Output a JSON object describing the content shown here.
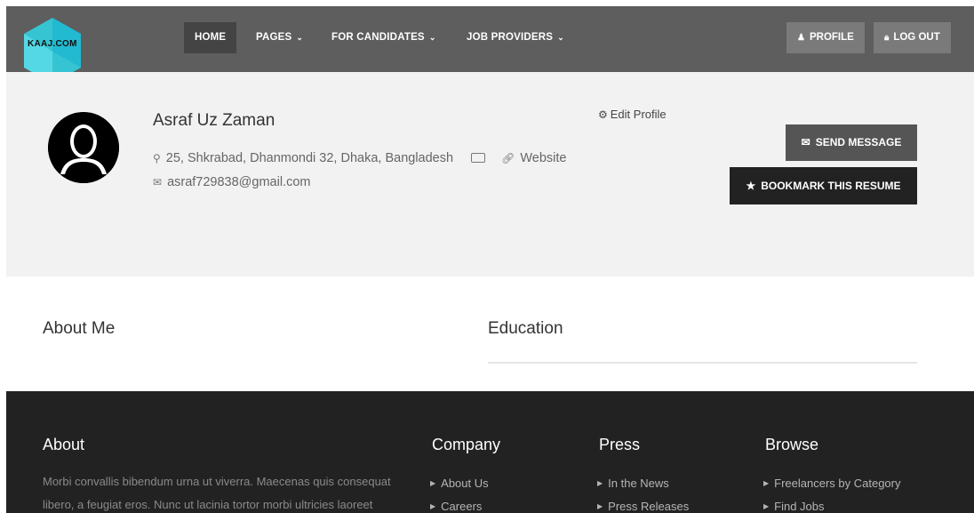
{
  "header": {
    "logo_text": "KAAJ.COM",
    "nav": [
      {
        "label": "HOME"
      },
      {
        "label": "PAGES"
      },
      {
        "label": "FOR CANDIDATES"
      },
      {
        "label": "JOB PROVIDERS"
      }
    ],
    "profile_label": "PROFILE",
    "logout_label": "LOG OUT"
  },
  "profile": {
    "name": "Asraf Uz Zaman",
    "address": "25, Shkrabad, Dhanmondi 32, Dhaka, Bangladesh",
    "website_label": "Website",
    "email": "asraf729838@gmail.com",
    "edit_label": "Edit Profile",
    "send_message_label": "SEND MESSAGE",
    "bookmark_label": "BOOKMARK THIS RESUME"
  },
  "sections": {
    "about_title": "About Me",
    "education_title": "Education"
  },
  "footer": {
    "about_title": "About",
    "about_text": "Morbi convallis bibendum urna ut viverra. Maecenas quis consequat libero, a feugiat eros. Nunc ut lacinia tortor morbi ultricies laoreet",
    "company": {
      "title": "Company",
      "links": [
        "About Us",
        "Careers"
      ]
    },
    "press": {
      "title": "Press",
      "links": [
        "In the News",
        "Press Releases"
      ]
    },
    "browse": {
      "title": "Browse",
      "links": [
        "Freelancers by Category",
        "Find Jobs"
      ]
    }
  },
  "colors": {
    "header_bg": "#5e5e5e",
    "profile_bg": "#f2f2f2",
    "footer_bg": "#222222",
    "logo_cyan": "#2fd6e8"
  },
  "icons": [
    "location-pin-icon",
    "money-icon",
    "link-icon",
    "envelope-icon",
    "gear-icon",
    "user-icon",
    "lock-icon",
    "star-icon",
    "chevron-down-icon",
    "caret-right-icon"
  ]
}
